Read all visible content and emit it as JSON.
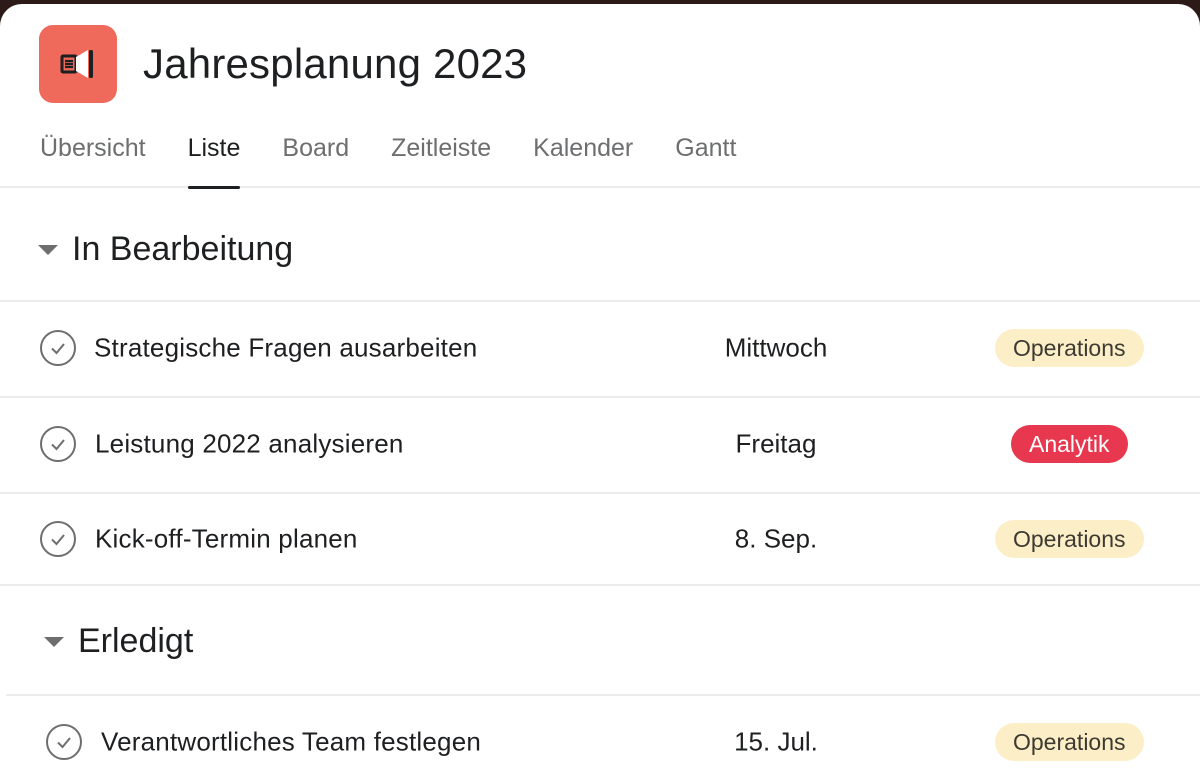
{
  "project": {
    "title": "Jahresplanung 2023",
    "icon": "megaphone-icon",
    "icon_color": "#f06a5b"
  },
  "tabs": [
    {
      "label": "Übersicht",
      "active": false
    },
    {
      "label": "Liste",
      "active": true
    },
    {
      "label": "Board",
      "active": false
    },
    {
      "label": "Zeitleiste",
      "active": false
    },
    {
      "label": "Kalender",
      "active": false
    },
    {
      "label": "Gantt",
      "active": false
    }
  ],
  "sections": [
    {
      "title": "In Bearbeitung",
      "tasks": [
        {
          "name": "Strategische Fragen ausarbeiten",
          "due": "Mittwoch",
          "tag": "Operations",
          "tag_color": "#fcefc8"
        },
        {
          "name": "Leistung 2022 analysieren",
          "due": "Freitag",
          "tag": "Analytik",
          "tag_color": "#e8384f"
        },
        {
          "name": "Kick-off-Termin planen",
          "due": "8. Sep.",
          "tag": "Operations",
          "tag_color": "#fcefc8"
        }
      ]
    },
    {
      "title": "Erledigt",
      "tasks": [
        {
          "name": "Verantwortliches Team festlegen",
          "due": "15. Jul.",
          "tag": "Operations",
          "tag_color": "#fcefc8"
        }
      ]
    }
  ]
}
